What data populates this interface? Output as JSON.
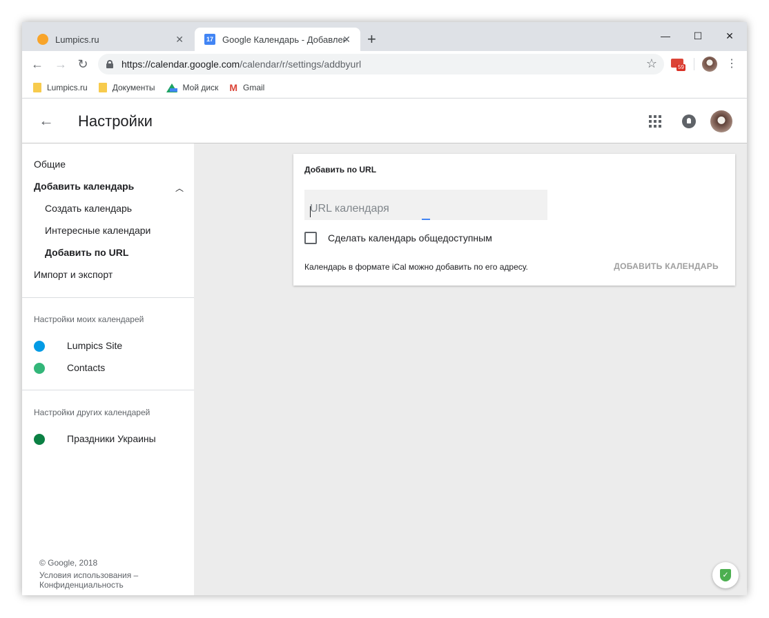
{
  "tabs": [
    {
      "title": "Lumpics.ru",
      "active": false
    },
    {
      "title": "Google Календарь - Добавление",
      "active": true,
      "favicon_text": "17"
    }
  ],
  "toolbar": {
    "url_host": "https://calendar.google.com",
    "url_path": "/calendar/r/settings/addbyurl",
    "gmail_badge": "59"
  },
  "bookmarks": [
    {
      "label": "Lumpics.ru",
      "icon": "folder-icon"
    },
    {
      "label": "Документы",
      "icon": "folder-icon"
    },
    {
      "label": "Мой диск",
      "icon": "drive-icon"
    },
    {
      "label": "Gmail",
      "icon": "gmail-icon"
    }
  ],
  "header": {
    "title": "Настройки"
  },
  "sidebar": {
    "items": [
      {
        "label": "Общие"
      },
      {
        "label": "Добавить календарь"
      },
      {
        "label": "Создать календарь"
      },
      {
        "label": "Интересные календари"
      },
      {
        "label": "Добавить по URL"
      },
      {
        "label": "Импорт и экспорт"
      }
    ],
    "my_calendars_title": "Настройки моих календарей",
    "my_calendars": [
      {
        "name": "Lumpics Site",
        "color": "#039be5"
      },
      {
        "name": "Contacts",
        "color": "#33b679"
      }
    ],
    "other_calendars_title": "Настройки других календарей",
    "other_calendars": [
      {
        "name": "Праздники Украины",
        "color": "#0b8043"
      }
    ],
    "footer": {
      "copyright": "© Google, 2018",
      "terms": "Условия использования –",
      "privacy": "Конфиденциальность"
    }
  },
  "card": {
    "title": "Добавить по URL",
    "url_placeholder": "URL календаря",
    "url_value": "",
    "public_checkbox_label": "Сделать календарь общедоступным",
    "public_checked": false,
    "hint": "Календарь в формате iCal можно добавить по его адресу.",
    "add_button": "ДОБАВИТЬ КАЛЕНДАРЬ"
  }
}
